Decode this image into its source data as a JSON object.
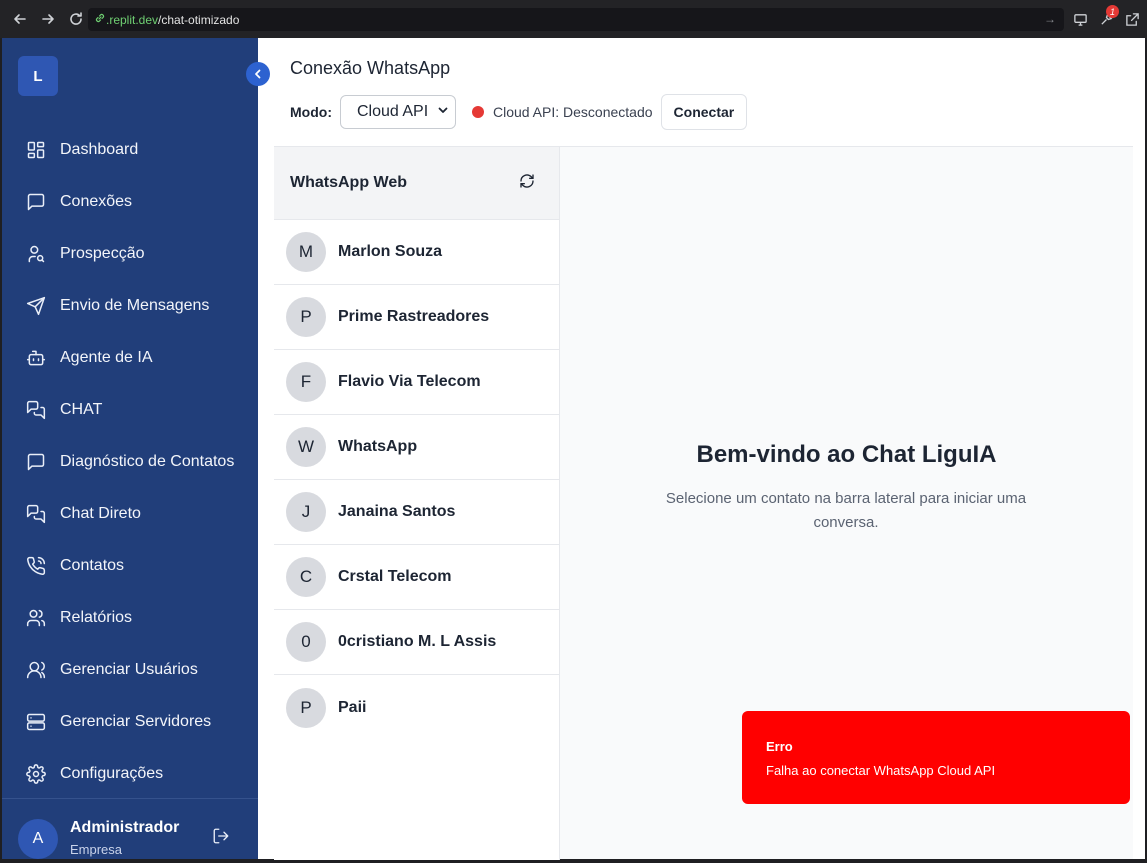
{
  "browser": {
    "url_host": ".replit.dev",
    "url_path": "/chat-otimizado",
    "extension_badge": "1"
  },
  "sidebar": {
    "logo_letter": "L",
    "items": [
      {
        "label": "Dashboard",
        "icon": "dashboard-icon"
      },
      {
        "label": "Conexões",
        "icon": "message-square-icon"
      },
      {
        "label": "Prospecção",
        "icon": "user-search-icon"
      },
      {
        "label": "Envio de Mensagens",
        "icon": "send-icon"
      },
      {
        "label": "Agente de IA",
        "icon": "bot-icon"
      },
      {
        "label": "CHAT",
        "icon": "messages-icon"
      },
      {
        "label": "Diagnóstico de Contatos",
        "icon": "message-square-icon"
      },
      {
        "label": "Chat Direto",
        "icon": "messages-icon"
      },
      {
        "label": "Contatos",
        "icon": "phone-icon"
      },
      {
        "label": "Relatórios",
        "icon": "users-icon"
      },
      {
        "label": "Gerenciar Usuários",
        "icon": "user-icon"
      },
      {
        "label": "Gerenciar Servidores",
        "icon": "server-icon"
      },
      {
        "label": "Configurações",
        "icon": "gear-icon"
      }
    ],
    "user": {
      "initial": "A",
      "name": "Administrador",
      "role": "Empresa"
    }
  },
  "header": {
    "title": "Conexão WhatsApp",
    "mode_label": "Modo:",
    "mode_value": "Cloud API",
    "status": "Cloud API: Desconectado",
    "connect_label": "Conectar"
  },
  "contacts": {
    "title": "WhatsApp Web",
    "list": [
      {
        "initial": "M",
        "name": "Marlon Souza"
      },
      {
        "initial": "P",
        "name": "Prime Rastreadores"
      },
      {
        "initial": "F",
        "name": "Flavio Via Telecom"
      },
      {
        "initial": "W",
        "name": "WhatsApp"
      },
      {
        "initial": "J",
        "name": "Janaina Santos"
      },
      {
        "initial": "C",
        "name": "Crstal Telecom"
      },
      {
        "initial": "0",
        "name": "0cristiano M. L Assis"
      },
      {
        "initial": "P",
        "name": "Paii"
      }
    ]
  },
  "welcome": {
    "title": "Bem-vindo ao Chat LiguIA",
    "subtitle": "Selecione um contato na barra lateral para iniciar uma conversa."
  },
  "toast": {
    "title": "Erro",
    "message": "Falha ao conectar WhatsApp Cloud API"
  },
  "colors": {
    "sidebar": "#213e7a",
    "accent": "#2f57b3",
    "error": "#ff0000",
    "status_dot": "#e53935"
  }
}
